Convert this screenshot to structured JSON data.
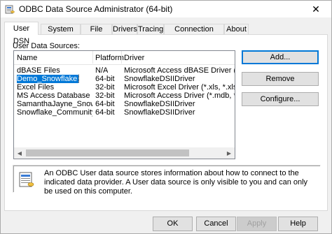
{
  "window": {
    "title": "ODBC Data Source Administrator (64-bit)",
    "close_glyph": "✕"
  },
  "tabs": [
    {
      "label": "User DSN",
      "active": true
    },
    {
      "label": "System DSN"
    },
    {
      "label": "File DSN"
    },
    {
      "label": "Drivers"
    },
    {
      "label": "Tracing"
    },
    {
      "label": "Connection Pooling"
    },
    {
      "label": "About"
    }
  ],
  "list": {
    "label": "User Data Sources:",
    "columns": [
      "Name",
      "Platform",
      "Driver"
    ],
    "rows": [
      {
        "name": "dBASE Files",
        "platform": "N/A",
        "driver": "Microsoft Access dBASE Driver (*.dbf, *.ndx"
      },
      {
        "name": "Demo_Snowflake",
        "platform": "64-bit",
        "driver": "SnowflakeDSIIDriver",
        "selected": true
      },
      {
        "name": "Excel Files",
        "platform": "32-bit",
        "driver": "Microsoft Excel Driver (*.xls, *.xlsx, *.xlsm, *."
      },
      {
        "name": "MS Access Database",
        "platform": "32-bit",
        "driver": "Microsoft Access Driver (*.mdb, *.accdb)"
      },
      {
        "name": "SamanthaJayne_Snowflake",
        "platform": "64-bit",
        "driver": "SnowflakeDSIIDriver"
      },
      {
        "name": "Snowflake_Community",
        "platform": "64-bit",
        "driver": "SnowflakeDSIIDriver"
      }
    ]
  },
  "side_buttons": {
    "add": "Add...",
    "remove": "Remove",
    "configure": "Configure..."
  },
  "info": {
    "text": "An ODBC User data source stores information about how to connect to the indicated data provider.  A User data source is only visible to you and can only be used on this computer."
  },
  "bottom_buttons": {
    "ok": "OK",
    "cancel": "Cancel",
    "apply": "Apply",
    "help": "Help"
  },
  "colors": {
    "selection": "#0078d7",
    "default_button_border": "#0078d7"
  }
}
